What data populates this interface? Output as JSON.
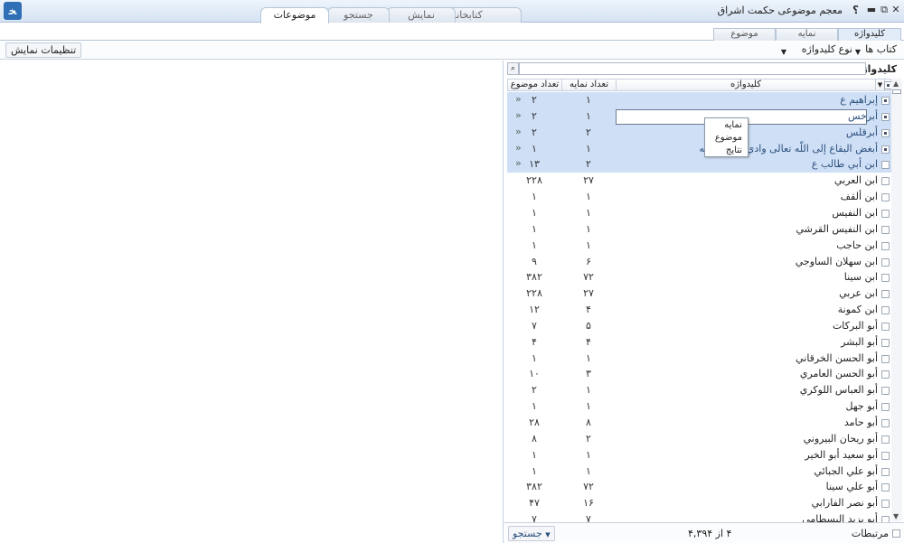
{
  "window": {
    "title": "معجم موضوعی حکمت اشراق",
    "help": "؟",
    "logo": "ﺨ",
    "controls": {
      "minimize": "▬",
      "restore": "⧉",
      "close": "✕"
    }
  },
  "top_tabs": [
    {
      "label": "کتابخانه"
    },
    {
      "label": "نمایش"
    },
    {
      "label": "جستجو"
    },
    {
      "label": "موضوعات"
    }
  ],
  "sub_tabs": [
    {
      "label": "کلیدواژه"
    },
    {
      "label": "نمایه"
    },
    {
      "label": "موضوع"
    }
  ],
  "toolbar": {
    "books": "کتاب ها",
    "keyword_type": "نوع کلیدواژه",
    "display_settings": "تنظیمات نمایش"
  },
  "panel": {
    "keyword_label": "کلیدواژه",
    "search_value": ""
  },
  "table": {
    "headers": {
      "keyword": "کلیدواژه",
      "index_count": "تعداد نمایه",
      "topic_count": "تعداد موضوع"
    },
    "rows": [
      {
        "kw": "إبراهيم ع",
        "index": "۱",
        "topic": "۲",
        "arrows": "»",
        "selected": true,
        "checked": true
      },
      {
        "kw": "أبرخس",
        "index": "۱",
        "topic": "۲",
        "arrows": "»",
        "selected": true,
        "checked": true
      },
      {
        "kw": "أبرقلس",
        "index": "۲",
        "topic": "۲",
        "arrows": "»",
        "selected": true,
        "checked": true
      },
      {
        "kw": "أبغض البقاع إلى اللّه تعالى وادي برهوت فيه",
        "index": "۱",
        "topic": "۱",
        "arrows": "»",
        "selected": true,
        "checked": true
      },
      {
        "kw": "ابن أبي طالب ع",
        "index": "۲",
        "topic": "۱۳",
        "arrows": "»",
        "selected": true,
        "checked": false
      },
      {
        "kw": "ابن العربي",
        "index": "۲۷",
        "topic": "۲۲۸"
      },
      {
        "kw": "ابن ألقف",
        "index": "۱",
        "topic": "۱"
      },
      {
        "kw": "ابن النفيس",
        "index": "۱",
        "topic": "۱"
      },
      {
        "kw": "ابن النفيس القرشي",
        "index": "۱",
        "topic": "۱"
      },
      {
        "kw": "ابن حاجب",
        "index": "۱",
        "topic": "۱"
      },
      {
        "kw": "ابن سهلان الساوجي",
        "index": "۶",
        "topic": "۹"
      },
      {
        "kw": "ابن سينا",
        "index": "۷۲",
        "topic": "۳۸۲"
      },
      {
        "kw": "ابن عربي",
        "index": "۲۷",
        "topic": "۲۲۸"
      },
      {
        "kw": "ابن كمونة",
        "index": "۴",
        "topic": "۱۲"
      },
      {
        "kw": "أبو البركات",
        "index": "۵",
        "topic": "۷"
      },
      {
        "kw": "أبو البشر",
        "index": "۴",
        "topic": "۴"
      },
      {
        "kw": "أبو الحسن الخرقاني",
        "index": "۱",
        "topic": "۱"
      },
      {
        "kw": "أبو الحسن العامري",
        "index": "۳",
        "topic": "۱۰"
      },
      {
        "kw": "أبو العباس اللوكري",
        "index": "۱",
        "topic": "۲"
      },
      {
        "kw": "أبو جهل",
        "index": "۱",
        "topic": "۱"
      },
      {
        "kw": "أبو حامد",
        "index": "۸",
        "topic": "۲۸"
      },
      {
        "kw": "أبو ريحان البيروني",
        "index": "۲",
        "topic": "۸"
      },
      {
        "kw": "أبو سعيد أبو الخير",
        "index": "۱",
        "topic": "۱"
      },
      {
        "kw": "أبو علي الجبائي",
        "index": "۱",
        "topic": "۱"
      },
      {
        "kw": "أبو علي سينا",
        "index": "۷۲",
        "topic": "۳۸۲"
      },
      {
        "kw": "أبو نصر الفارابي",
        "index": "۱۶",
        "topic": "۴۷"
      },
      {
        "kw": "أبو يزيد البسطامي",
        "index": "۷",
        "topic": "۷"
      }
    ]
  },
  "context_menu": {
    "items": [
      "نمایه",
      "موضوع",
      "نتایج"
    ]
  },
  "status": {
    "related": "مرتبطات",
    "pager": "۴ از ۴,۳۹۴",
    "search_button": "جستجو"
  }
}
